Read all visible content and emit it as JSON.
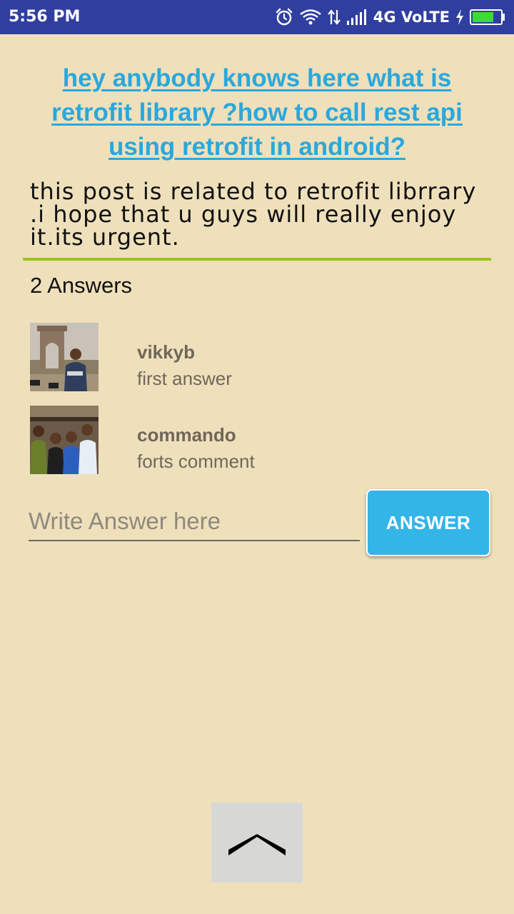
{
  "status_bar": {
    "time": "5:56 PM",
    "network": "4G VoLTE"
  },
  "question": {
    "title": "hey anybody knows here what is retrofit library ?how to call rest api using retrofit in android?",
    "body": "this post is related to retrofit librrary .i hope that u guys will really enjoy it.its urgent."
  },
  "answers": {
    "count_label": "2 Answers",
    "items": [
      {
        "user": "vikkyb",
        "text": "first answer"
      },
      {
        "user": "commando",
        "text": "forts comment"
      }
    ]
  },
  "compose": {
    "placeholder": "Write Answer here",
    "button_label": "ANSWER"
  },
  "colors": {
    "background": "#efe0bc",
    "status_bar": "#303f9f",
    "title_link": "#2aa8dc",
    "divider": "#9cc518",
    "button": "#34b5e8"
  },
  "icons": [
    "alarm-icon",
    "wifi-icon",
    "data-arrows-icon",
    "signal-icon",
    "charging-icon",
    "battery-icon",
    "chevron-up-icon"
  ]
}
